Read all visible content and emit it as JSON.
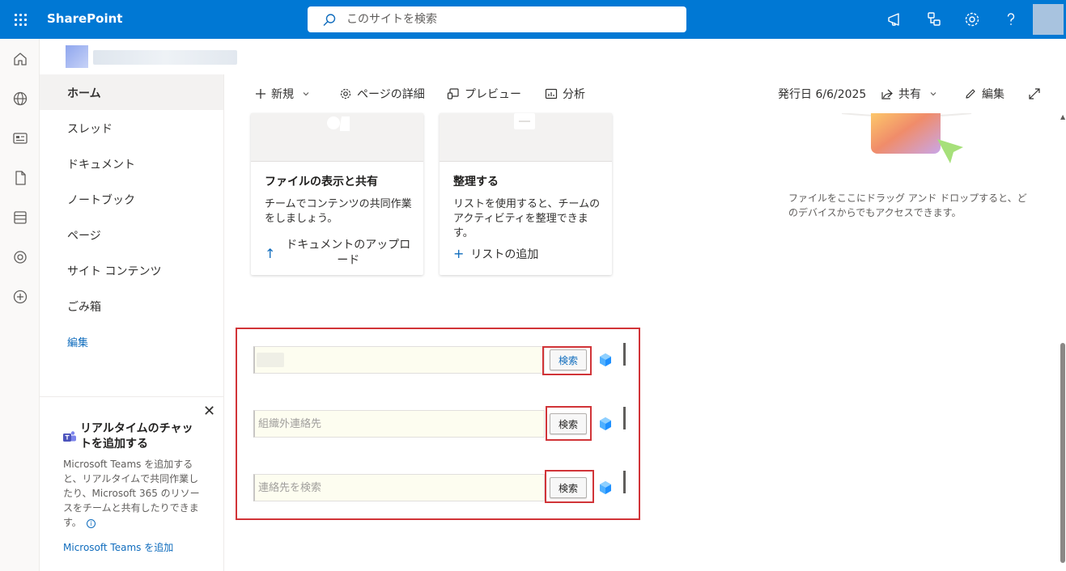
{
  "suite": {
    "brand": "SharePoint",
    "search_placeholder": "このサイトを検索"
  },
  "nav": {
    "items": [
      {
        "label": "ホーム",
        "selected": true
      },
      {
        "label": "スレッド"
      },
      {
        "label": "ドキュメント"
      },
      {
        "label": "ノートブック"
      },
      {
        "label": "ページ"
      },
      {
        "label": "サイト コンテンツ"
      },
      {
        "label": "ごみ箱"
      }
    ],
    "edit": "編集"
  },
  "teams": {
    "title": "リアルタイムのチャットを追加する",
    "desc": "Microsoft Teams を追加すると、リアルタイムで共同作業したり、Microsoft 365 のリソースをチームと共有したりできます。",
    "link": "Microsoft Teams を追加"
  },
  "command": {
    "new": "新規",
    "page_details": "ページの詳細",
    "preview": "プレビュー",
    "analytics": "分析",
    "published": "発行日 6/6/2025",
    "share": "共有",
    "edit": "編集"
  },
  "cards": [
    {
      "title": "ファイルの表示と共有",
      "desc": "チームでコンテンツの共同作業をしましょう。",
      "action": "ドキュメントのアップロード"
    },
    {
      "title": "整理する",
      "desc": "リストを使用すると、チームのアクティビティを整理できます。",
      "action": "リストの追加"
    }
  ],
  "drop_hint": "ファイルをここにドラッグ アンド ドロップすると、どのデバイスからでもアクセスできます。",
  "search_webpart": {
    "rows": [
      {
        "placeholder": "",
        "button": "検索"
      },
      {
        "placeholder": "組織外連絡先",
        "button": "検索"
      },
      {
        "placeholder": "連絡先を検索",
        "button": "検索"
      }
    ]
  },
  "colors": {
    "suite_bar": "#0078d4",
    "accent": "#0f6cbd",
    "highlight": "#d13438"
  }
}
